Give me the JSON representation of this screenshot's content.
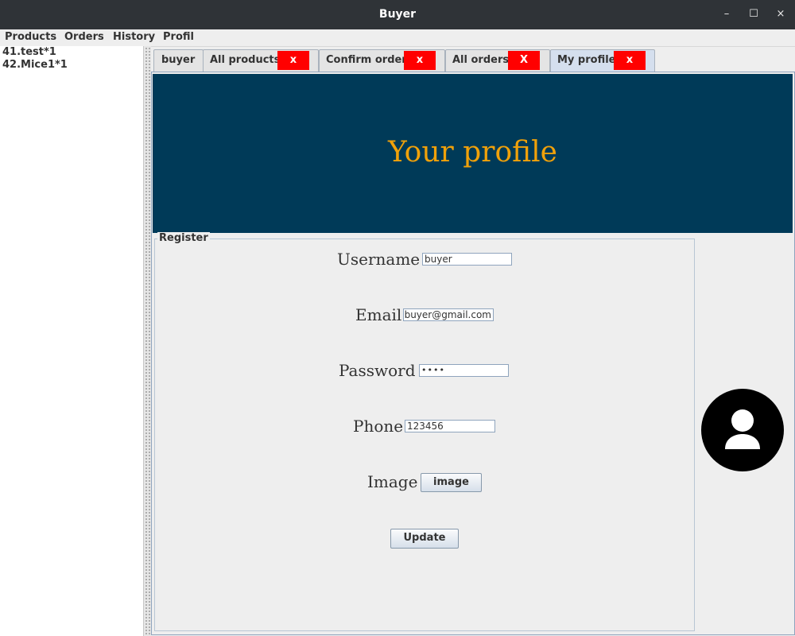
{
  "window": {
    "title": "Buyer",
    "controls": {
      "minimize": "–",
      "maximize": "☐",
      "close": "×"
    }
  },
  "menu": {
    "items": [
      "Products",
      "Orders",
      "History",
      "Profil"
    ]
  },
  "cart_list": {
    "items": [
      "41.test*1",
      "42.Mice1*1"
    ]
  },
  "tabs": [
    {
      "label": "buyer"
    },
    {
      "label": "All products",
      "close": "x"
    },
    {
      "label": "Confirm order",
      "close": "x"
    },
    {
      "label": "All orders",
      "close": "X"
    },
    {
      "label": "My profile",
      "close": "x",
      "active": true
    }
  ],
  "profile": {
    "heading": "Your profile",
    "group_title": "Register",
    "username": {
      "label": "Username",
      "value": "buyer"
    },
    "email": {
      "label": "Email",
      "value": "buyer@gmail.com"
    },
    "password": {
      "label": "Password",
      "value": "••••"
    },
    "phone": {
      "label": "Phone",
      "value": "123456"
    },
    "image": {
      "label": "Image",
      "button": "image"
    },
    "update_button": "Update",
    "avatar_icon": "user-silhouette-icon"
  },
  "colors": {
    "banner_bg": "#003a58",
    "heading": "#f0a10a",
    "tab_close": "#ff0000"
  }
}
